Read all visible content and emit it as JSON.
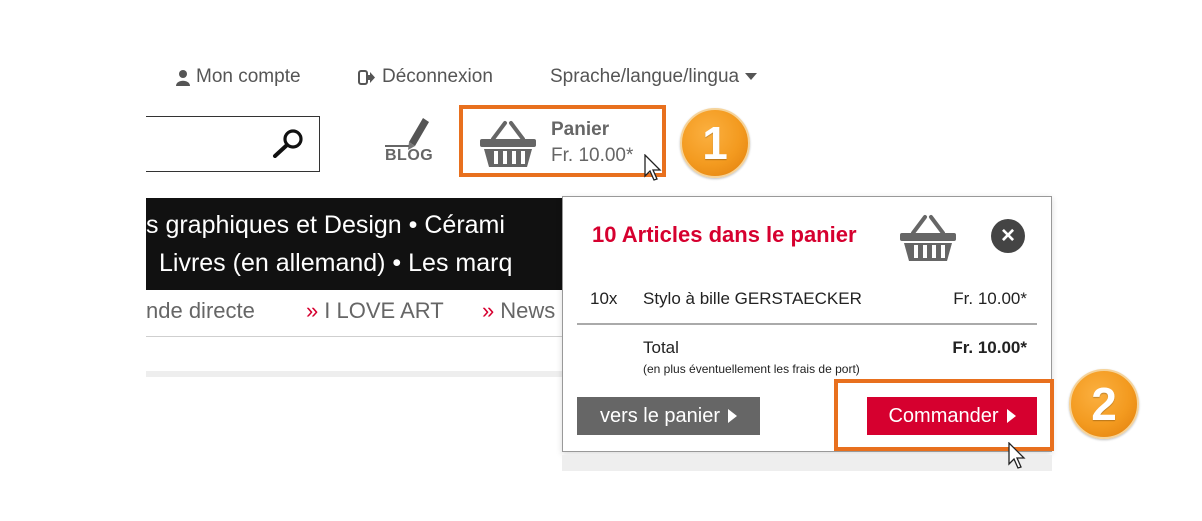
{
  "header": {
    "account_label": "Mon compte",
    "logout_label": "Déconnexion",
    "language_label": "Sprache/langue/lingua"
  },
  "search": {
    "value": ""
  },
  "blog": {
    "label": "BLOG"
  },
  "cart": {
    "title": "Panier",
    "amount": "Fr. 10.00*"
  },
  "badges": {
    "one": "1",
    "two": "2"
  },
  "nav": {
    "line1": "s graphiques et Design   •   Cérami",
    "line2": "Livres (en allemand)   •   Les marq"
  },
  "subnav": {
    "item1": "nde directe",
    "item2": "I LOVE ART",
    "item3": "News",
    "marker": "»"
  },
  "dropdown": {
    "title": "10 Articles dans le panier",
    "item_qty": "10x",
    "item_name": "Stylo à bille GERSTAECKER",
    "item_price": "Fr. 10.00*",
    "total_label": "Total",
    "total_value": "Fr. 10.00*",
    "shipping_note": "(en plus éventuellement les frais de port)",
    "view_cart_label": "vers le panier",
    "order_label": "Commander"
  },
  "colors": {
    "accent": "#e8701e",
    "brand_red": "#d6002f",
    "badge": "#f39a1f"
  }
}
